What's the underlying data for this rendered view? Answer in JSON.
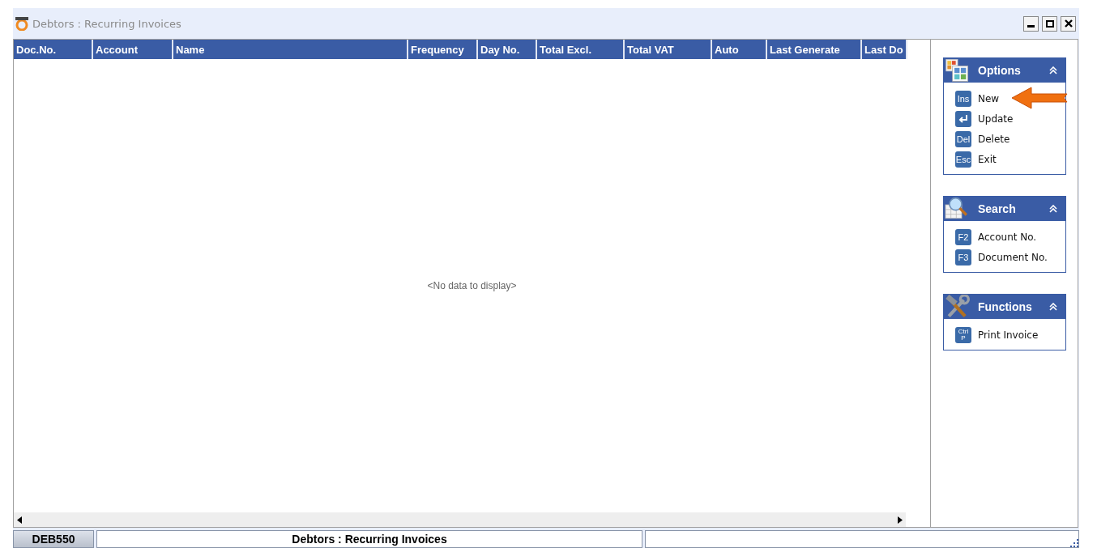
{
  "window": {
    "title": "Debtors : Recurring Invoices"
  },
  "table": {
    "columns": [
      {
        "label": "Doc.No."
      },
      {
        "label": "Account"
      },
      {
        "label": "Name"
      },
      {
        "label": "Frequency"
      },
      {
        "label": "Day No."
      },
      {
        "label": "Total Excl."
      },
      {
        "label": "Total VAT"
      },
      {
        "label": "Auto"
      },
      {
        "label": "Last Generate"
      },
      {
        "label": "Last Do"
      }
    ],
    "empty_text": "<No data to display>"
  },
  "panels": [
    {
      "title": "Options",
      "kind": "options",
      "expanded": true,
      "items": [
        {
          "kind": "key",
          "key": "Ins",
          "label": "New",
          "pointed": true
        },
        {
          "kind": "enter",
          "label": "Update",
          "pointed": false
        },
        {
          "kind": "key",
          "key": "Del",
          "label": "Delete",
          "pointed": false
        },
        {
          "kind": "key",
          "key": "Esc",
          "label": "Exit",
          "pointed": false
        }
      ]
    },
    {
      "title": "Search",
      "kind": "search",
      "expanded": true,
      "items": [
        {
          "kind": "key",
          "key": "F2",
          "label": "Account No.",
          "pointed": false
        },
        {
          "kind": "key",
          "key": "F3",
          "label": "Document No.",
          "pointed": false
        }
      ]
    },
    {
      "title": "Functions",
      "kind": "functions",
      "expanded": true,
      "items": [
        {
          "kind": "stack",
          "key": "Ctrl",
          "key2": "P",
          "label": "Print Invoice",
          "pointed": false
        }
      ]
    }
  ],
  "status_bar": {
    "code": "DEB550",
    "title": "Debtors : Recurring Invoices"
  }
}
